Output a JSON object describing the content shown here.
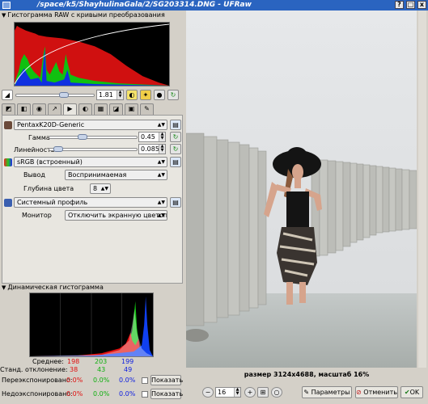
{
  "window": {
    "title": "/space/k5/ShayhulinaGala/2/SG203314.DNG - UFRaw",
    "buttons": [
      "?",
      "□",
      "x"
    ]
  },
  "raw_histogram": {
    "header": "Гистограмма RAW с кривыми преобразования"
  },
  "curve_controls": {
    "value": "1.81"
  },
  "tabs": [
    {
      "name": "tab-exposure",
      "glyph": "◩",
      "active": false
    },
    {
      "name": "tab-white-balance",
      "glyph": "◧",
      "active": false
    },
    {
      "name": "tab-grayscale",
      "glyph": "◉",
      "active": false
    },
    {
      "name": "tab-curves",
      "glyph": "↗",
      "active": false
    },
    {
      "name": "tab-color-management",
      "glyph": "▶",
      "active": true
    },
    {
      "name": "tab-lightness",
      "glyph": "◐",
      "active": false
    },
    {
      "name": "tab-crop",
      "glyph": "▦",
      "active": false
    },
    {
      "name": "tab-transform",
      "glyph": "◪",
      "active": false
    },
    {
      "name": "tab-save",
      "glyph": "▣",
      "active": false
    },
    {
      "name": "tab-exif",
      "glyph": "✎",
      "active": false
    }
  ],
  "color_panel": {
    "input_profile": "PentaxK20D-Generic",
    "gamma_label": "Гамма",
    "gamma_value": "0.45",
    "linearity_label": "Линейность",
    "linearity_value": "0.085",
    "output_profile": "sRGB (встроенный)",
    "intent_label": "Вывод",
    "intent_value": "Воспринимаемая",
    "bit_depth_label": "Глубина цвета",
    "bit_depth_value": "8",
    "display_profile": "Системный профиль",
    "monitor_label": "Монитор",
    "monitor_value": "Отключить экранную цветопробу"
  },
  "dynamic_histogram": {
    "header": "Динамическая гистограмма",
    "average_label": "Среднее:",
    "average": [
      "198",
      "203",
      "199"
    ],
    "std_label": "Станд. отклонение:",
    "std": [
      "38",
      "43",
      "49"
    ],
    "over_label": "Переэкспонировано:",
    "over": [
      "0.0%",
      "0.0%",
      "0.0%"
    ],
    "under_label": "Недоэкспонировано:",
    "under": [
      "0.0%",
      "0.0%",
      "0.0%"
    ],
    "show_label": "Показать"
  },
  "preview": {
    "status": "размер 3124x4688, масштаб 16%",
    "zoom": "16"
  },
  "actions": {
    "options": "Параметры",
    "cancel": "Отменить",
    "ok": "OK"
  },
  "colors": {
    "titlebar": "#2a64c0",
    "red": "#e01010",
    "green": "#10b010",
    "blue": "#1020e0"
  }
}
